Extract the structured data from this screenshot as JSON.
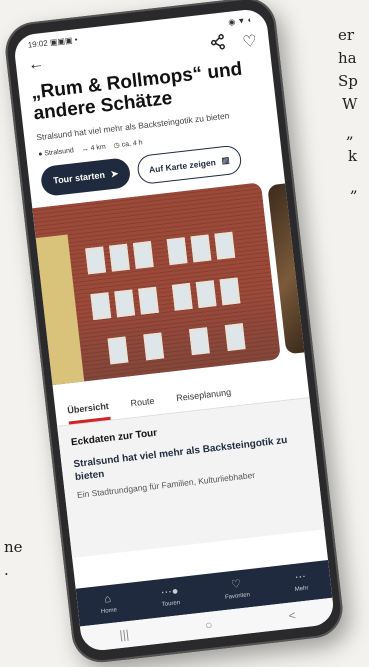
{
  "background_text": {
    "right_lines": [
      "er",
      "ha",
      "Sp",
      "W",
      "„",
      "k",
      "„"
    ],
    "left_lines": [
      "ne",
      "."
    ]
  },
  "status": {
    "time": "19:02",
    "icons_left": "▣▣▣ •",
    "icons_right": "◉ ▼ ◐"
  },
  "topbar": {
    "back_icon": "arrow-left-icon",
    "share_icon": "share-icon",
    "favorite_icon": "heart-icon"
  },
  "tour": {
    "title": "„Rum & Rollmops“ und andere Schätze",
    "subtitle": "Stralsund hat viel mehr als Backsteingotik zu bieten",
    "location": "Stralsund",
    "distance": "4 km",
    "duration": "ca. 4 h"
  },
  "buttons": {
    "start_tour": "Tour starten",
    "show_map": "Auf Karte zeigen"
  },
  "tabs": [
    {
      "label": "Übersicht",
      "active": true
    },
    {
      "label": "Route",
      "active": false
    },
    {
      "label": "Reiseplanung",
      "active": false
    }
  ],
  "overview": {
    "heading": "Eckdaten zur Tour",
    "subheading": "Stralsund hat viel mehr als Backsteingotik zu bieten",
    "body": "Ein Stadtrundgang für Familien, Kulturliebhaber"
  },
  "bottom_nav": [
    {
      "label": "Home",
      "icon": "home-icon"
    },
    {
      "label": "Touren",
      "icon": "route-icon"
    },
    {
      "label": "Favoriten",
      "icon": "heart-icon"
    },
    {
      "label": "Mehr",
      "icon": "more-icon"
    }
  ],
  "system_nav": {
    "recent": "|||",
    "home": "○",
    "back": "<"
  }
}
